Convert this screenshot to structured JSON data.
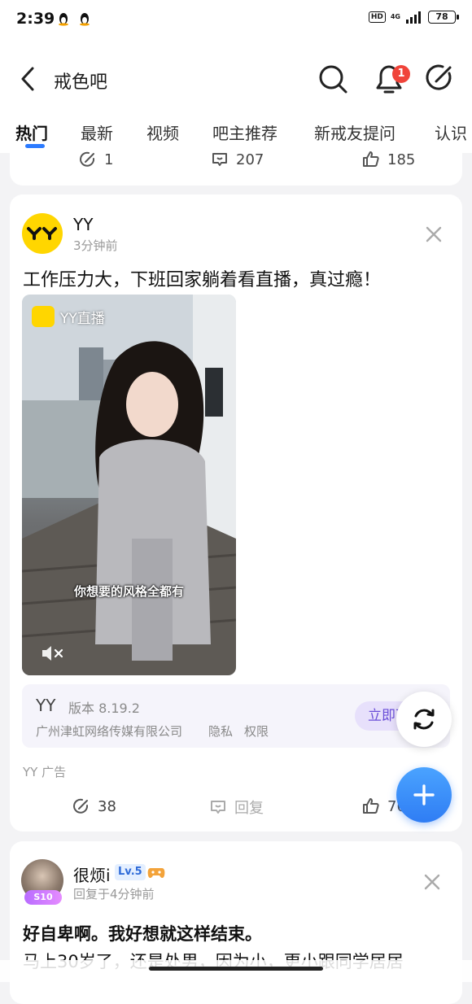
{
  "status_bar": {
    "time": "2:39",
    "hd": "HD",
    "network": "4G",
    "battery": "78"
  },
  "header": {
    "title": "戒色吧",
    "notification_count": "1"
  },
  "tabs": [
    {
      "label": "热门",
      "active": true
    },
    {
      "label": "最新"
    },
    {
      "label": "视频"
    },
    {
      "label": "吧主推荐"
    },
    {
      "label": "新戒友提问"
    },
    {
      "label": "认识"
    }
  ],
  "prev_post": {
    "shares": "1",
    "comments": "207",
    "likes": "185"
  },
  "ad_post": {
    "author": "YY",
    "time": "3分钟前",
    "text": "工作压力大，下班回家躺着看直播，真过瘾！",
    "video_label": "YY直播",
    "video_caption": "你想要的风格全都有",
    "app_name": "YY",
    "app_version": "版本 8.19.2",
    "company": "广州津虹网络传媒有限公司",
    "privacy": "隐私",
    "permissions": "权限",
    "cta": "立即下载",
    "ad_label": "YY  广告",
    "shares": "38",
    "reply_label": "回复",
    "likes": "76"
  },
  "user_post": {
    "author": "很烦i",
    "level": "Lv.5",
    "avatar_badge": "S10",
    "time": "回复于4分钟前",
    "title": "好自卑啊。我好想就这样结束。",
    "body": "马上30岁了，还是处男，因为小，更小跟同学居居"
  },
  "colors": {
    "accent": "#2c7bff",
    "badge": "#f0443a",
    "fab": "#2f7df4",
    "cta_text": "#6b4fd8"
  }
}
